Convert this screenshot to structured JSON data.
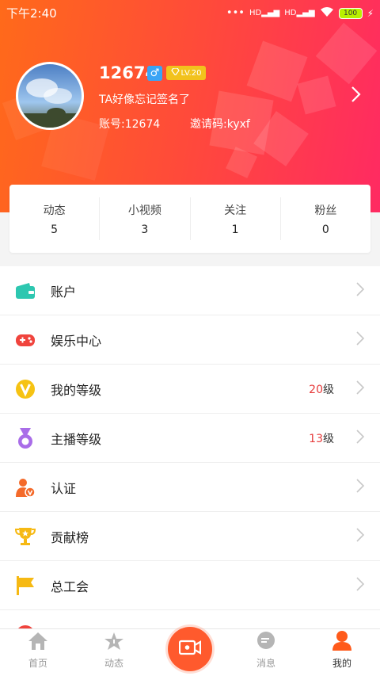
{
  "status_bar": {
    "time": "下午2:40",
    "network1": "HD",
    "network2": "HD",
    "battery": "100"
  },
  "profile": {
    "username": "12674",
    "gender_symbol": "♂",
    "level_badge": "LV.20",
    "signature": "TA好像忘记签名了",
    "account": "账号:12674",
    "invite_code": "邀请码:kyxf",
    "arrow": "›"
  },
  "stats": [
    {
      "label": "动态",
      "value": "5"
    },
    {
      "label": "小视频",
      "value": "3"
    },
    {
      "label": "关注",
      "value": "1"
    },
    {
      "label": "粉丝",
      "value": "0"
    }
  ],
  "menu": [
    {
      "label": "账户",
      "icon": "wallet-icon"
    },
    {
      "label": "娱乐中心",
      "icon": "gamepad-icon"
    },
    {
      "label": "我的等级",
      "icon": "vip-icon",
      "value": "20",
      "unit": "级"
    },
    {
      "label": "主播等级",
      "icon": "medal-icon",
      "value": "13",
      "unit": "级"
    },
    {
      "label": "认证",
      "icon": "verified-user-icon"
    },
    {
      "label": "贡献榜",
      "icon": "trophy-icon"
    },
    {
      "label": "总工会",
      "icon": "flag-icon"
    }
  ],
  "tabs": [
    {
      "label": "首页",
      "icon": "home-icon"
    },
    {
      "label": "动态",
      "icon": "star-icon"
    },
    {
      "label": "",
      "icon": "video-record-icon"
    },
    {
      "label": "消息",
      "icon": "message-icon"
    },
    {
      "label": "我的",
      "icon": "person-icon"
    }
  ],
  "colors": {
    "accent": "#ff5a2d",
    "gradient_start": "#ff6a1a",
    "gradient_end": "#ff2a62",
    "level_red": "#e63b3b"
  }
}
